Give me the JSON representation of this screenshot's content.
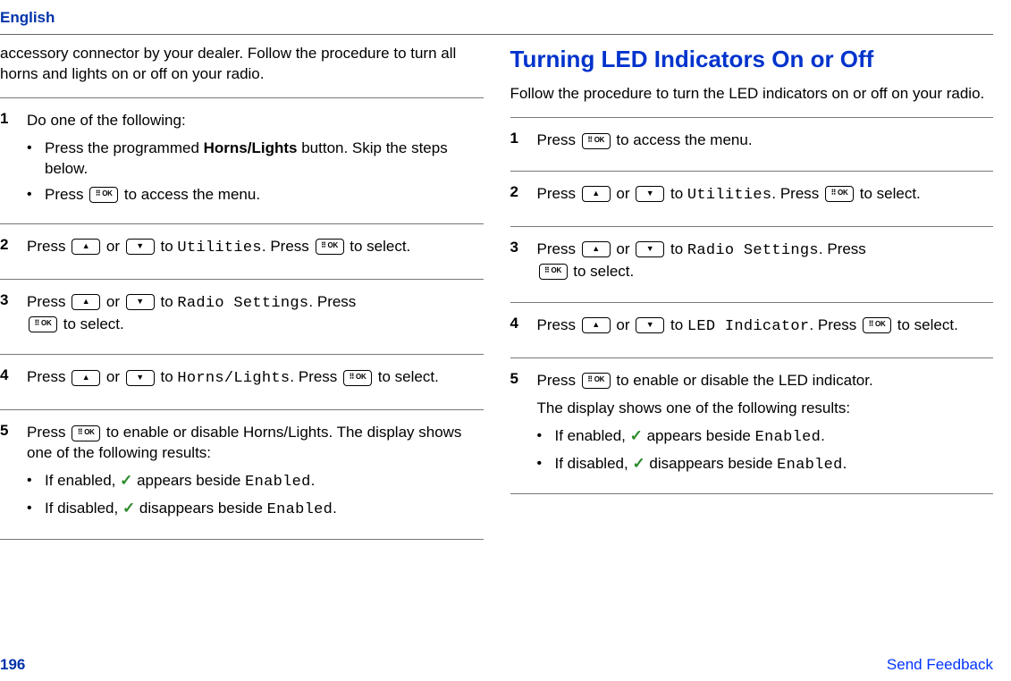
{
  "header": {
    "language": "English"
  },
  "left": {
    "intro": "accessory connector by your dealer. Follow the procedure to turn all horns and lights on or off on your radio.",
    "step1": {
      "lead": "Do one of the following:",
      "bullet1a": "Press the programmed ",
      "bullet1b": "Horns/Lights",
      "bullet1c": " button. Skip the steps below.",
      "bullet2a": "Press ",
      "bullet2b": " to access the menu."
    },
    "step2": {
      "a": "Press ",
      "b": " or ",
      "c": " to ",
      "menu": "Utilities",
      "d": ". Press ",
      "e": " to select."
    },
    "step3": {
      "a": "Press ",
      "b": " or ",
      "c": " to ",
      "menu": "Radio Settings",
      "d": ". Press ",
      "e": " to select."
    },
    "step4": {
      "a": "Press ",
      "b": " or ",
      "c": " to ",
      "menu": "Horns/Lights",
      "d": ". Press ",
      "e": " to select."
    },
    "step5": {
      "a": "Press ",
      "b": " to enable or disable Horns/Lights. The display shows one of the following results:",
      "enabled_a": "If enabled, ",
      "enabled_b": " appears beside ",
      "enabled_menu": "Enabled",
      "enabled_c": ".",
      "disabled_a": "If disabled, ",
      "disabled_b": " disappears beside ",
      "disabled_menu": "Enabled",
      "disabled_c": "."
    }
  },
  "right": {
    "title": "Turning LED Indicators On or Off",
    "intro": "Follow the procedure to turn the LED indicators on or off on your radio.",
    "step1": {
      "a": "Press ",
      "b": " to access the menu."
    },
    "step2": {
      "a": "Press ",
      "b": " or ",
      "c": " to ",
      "menu": "Utilities",
      "d": ". Press ",
      "e": " to select."
    },
    "step3": {
      "a": "Press ",
      "b": " or ",
      "c": " to ",
      "menu": "Radio Settings",
      "d": ". Press ",
      "e": " to select."
    },
    "step4": {
      "a": "Press ",
      "b": " or ",
      "c": " to ",
      "menu": "LED Indicator",
      "d": ". Press ",
      "e": " to select."
    },
    "step5": {
      "a": "Press ",
      "b": " to enable or disable the LED indicator.",
      "result_lead": "The display shows one of the following results:",
      "enabled_a": "If enabled, ",
      "enabled_b": " appears beside ",
      "enabled_menu": "Enabled",
      "enabled_c": ".",
      "disabled_a": "If disabled, ",
      "disabled_b": " disappears beside ",
      "disabled_menu": "Enabled",
      "disabled_c": "."
    }
  },
  "nums": {
    "n1": "1",
    "n2": "2",
    "n3": "3",
    "n4": "4",
    "n5": "5"
  },
  "footer": {
    "page": "196",
    "feedback": "Send Feedback"
  },
  "check": "✓"
}
